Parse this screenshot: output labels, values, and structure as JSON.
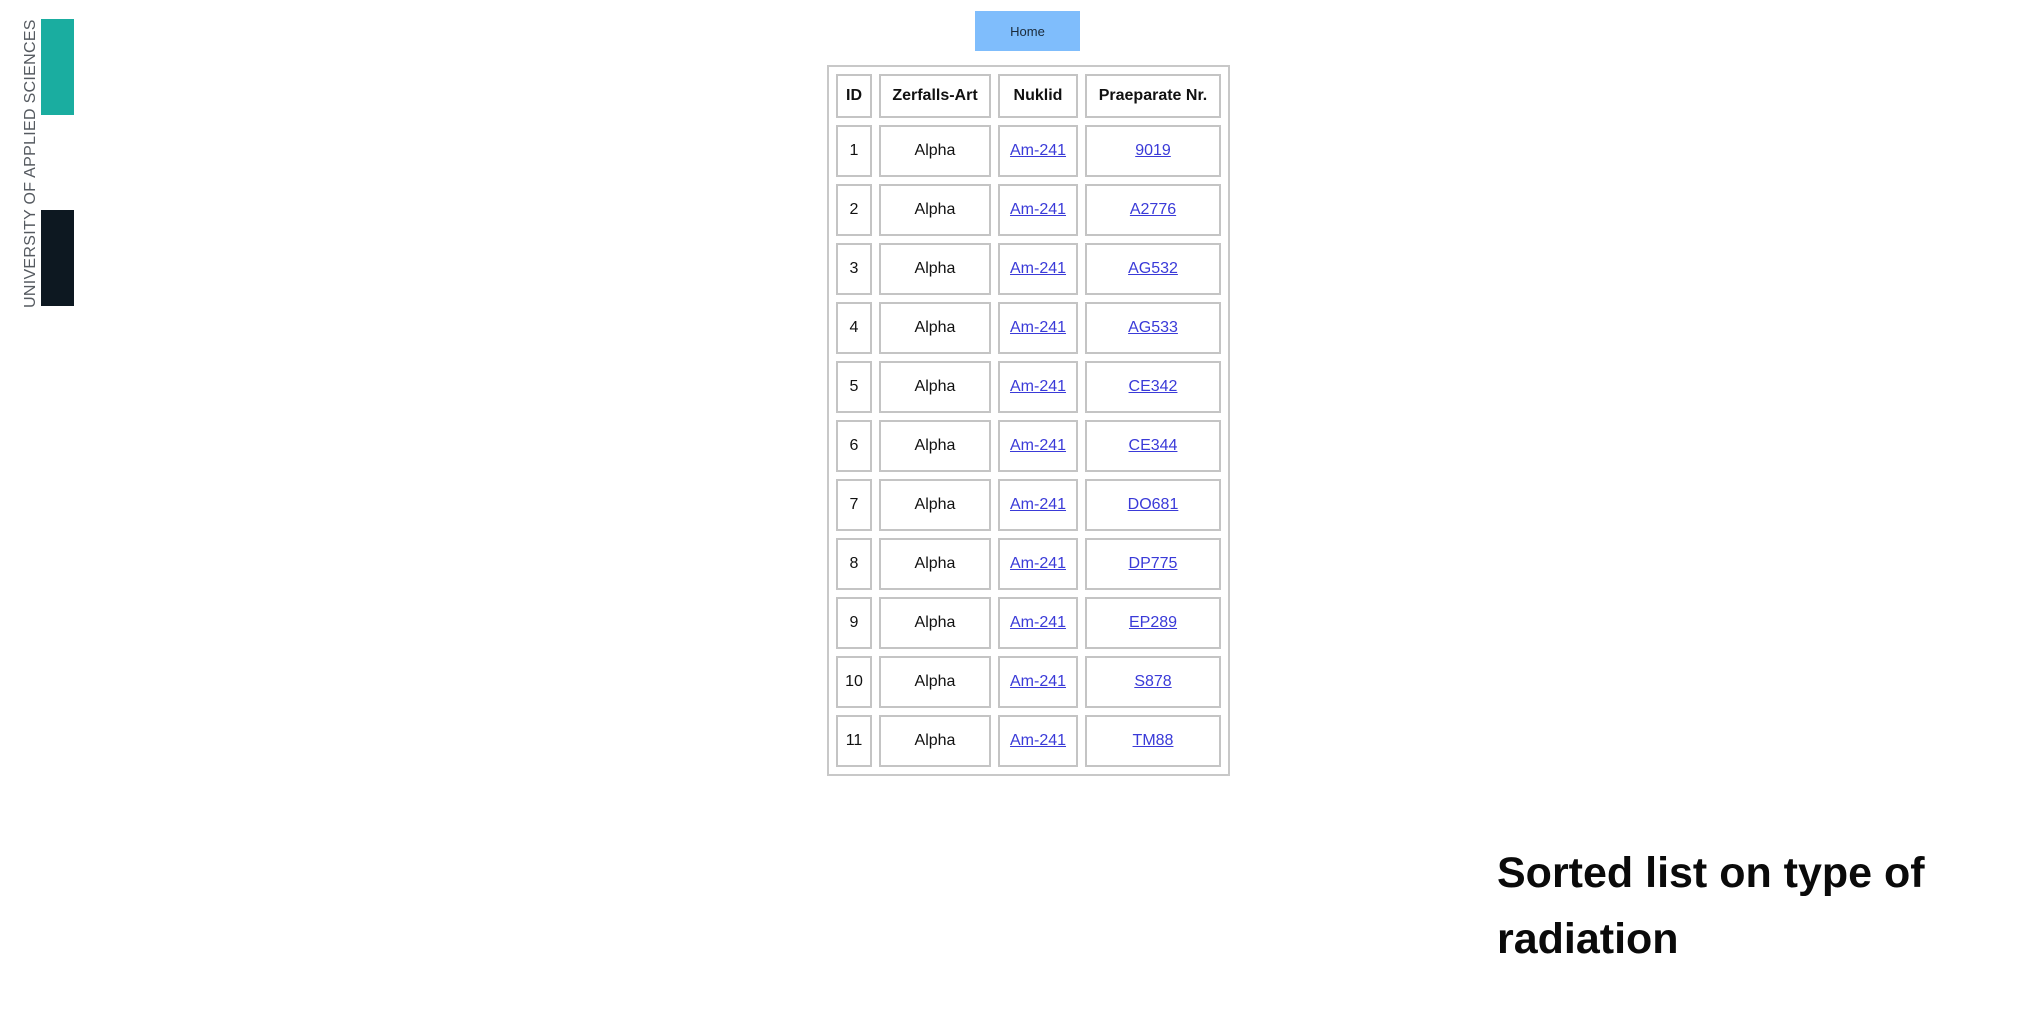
{
  "logo": {
    "text": "UNIVERSITY OF APPLIED SCIENCES",
    "colors": {
      "teal": "#1aada0",
      "dark": "#0d1821"
    }
  },
  "nav": {
    "home_label": "Home",
    "home_color": "#7fbdfc"
  },
  "table": {
    "headers": {
      "id": "ID",
      "art": "Zerfalls-Art",
      "nuklid": "Nuklid",
      "praeparat": "Praeparate Nr."
    },
    "rows": [
      {
        "id": "1",
        "art": "Alpha",
        "nuklid": "Am-241",
        "praeparat": "9019"
      },
      {
        "id": "2",
        "art": "Alpha",
        "nuklid": "Am-241",
        "praeparat": "A2776"
      },
      {
        "id": "3",
        "art": "Alpha",
        "nuklid": "Am-241",
        "praeparat": "AG532"
      },
      {
        "id": "4",
        "art": "Alpha",
        "nuklid": "Am-241",
        "praeparat": "AG533"
      },
      {
        "id": "5",
        "art": "Alpha",
        "nuklid": "Am-241",
        "praeparat": "CE342"
      },
      {
        "id": "6",
        "art": "Alpha",
        "nuklid": "Am-241",
        "praeparat": "CE344"
      },
      {
        "id": "7",
        "art": "Alpha",
        "nuklid": "Am-241",
        "praeparat": "DO681"
      },
      {
        "id": "8",
        "art": "Alpha",
        "nuklid": "Am-241",
        "praeparat": "DP775"
      },
      {
        "id": "9",
        "art": "Alpha",
        "nuklid": "Am-241",
        "praeparat": "EP289"
      },
      {
        "id": "10",
        "art": "Alpha",
        "nuklid": "Am-241",
        "praeparat": "S878"
      },
      {
        "id": "11",
        "art": "Alpha",
        "nuklid": "Am-241",
        "praeparat": "TM88"
      }
    ]
  },
  "caption": {
    "line1": "Sorted list on type of",
    "line2": "radiation"
  }
}
